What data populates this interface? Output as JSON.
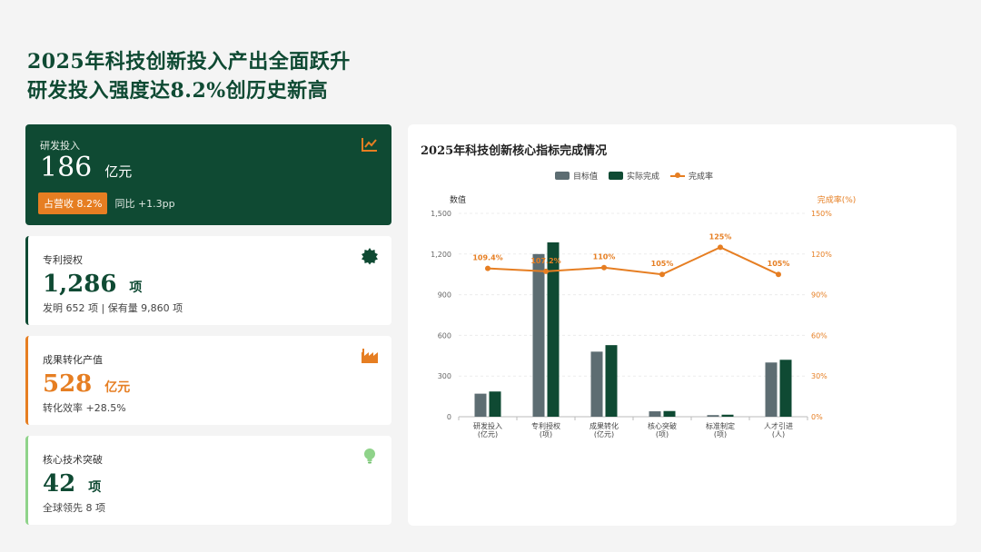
{
  "headline": {
    "line1": "2025年科技创新投入产出全面跃升",
    "line2": "研发投入强度达8.2%创历史新高"
  },
  "cards": {
    "rd": {
      "label": "研发投入",
      "value": "186",
      "unit": "亿元",
      "badge": "占营收 8.2%",
      "yoy": "同比 +1.3pp",
      "icon": "trend-chart-icon"
    },
    "patent": {
      "label": "专利授权",
      "value": "1,286",
      "unit": "项",
      "note": "发明 652 项 | 保有量 9,860 项",
      "icon": "seal-badge-icon"
    },
    "transfer": {
      "label": "成果转化产值",
      "value": "528",
      "unit": "亿元",
      "note": "转化效率 +28.5%",
      "icon": "factory-icon"
    },
    "breakthrough": {
      "label": "核心技术突破",
      "value": "42",
      "unit": "项",
      "note": "全球领先 8 项",
      "icon": "lightbulb-icon"
    }
  },
  "colors": {
    "brand": "#0f4a33",
    "accent": "#e67e22",
    "target": "#5d6d72",
    "light_green": "#8fd38a"
  },
  "chart_data": {
    "type": "bar",
    "title": "2025年科技创新核心指标完成情况",
    "categories": [
      "研发投入\n(亿元)",
      "专利授权\n(项)",
      "成果转化\n(亿元)",
      "核心突破\n(项)",
      "标准制定\n(项)",
      "人才引进\n(人)"
    ],
    "series": [
      {
        "name": "目标值",
        "type": "bar",
        "axis": "left",
        "color": "#5d6d72",
        "values": [
          170,
          1200,
          480,
          40,
          12,
          400
        ]
      },
      {
        "name": "实际完成",
        "type": "bar",
        "axis": "left",
        "color": "#0f4a33",
        "values": [
          186,
          1286,
          528,
          42,
          15,
          420
        ]
      },
      {
        "name": "完成率",
        "type": "line",
        "axis": "right",
        "color": "#e67e22",
        "values": [
          109.4,
          107.2,
          110,
          105,
          125,
          105
        ]
      }
    ],
    "data_labels": [
      "109.4%",
      "107.2%",
      "110%",
      "105%",
      "125%",
      "105%"
    ],
    "ylabel": "数值",
    "y2label": "完成率(%)",
    "ylim": [
      0,
      1500
    ],
    "yticks": [
      "0",
      "300",
      "600",
      "900",
      "1,200",
      "1,500"
    ],
    "y2lim": [
      0,
      150
    ],
    "y2ticks": [
      "0%",
      "30%",
      "60%",
      "90%",
      "120%",
      "150%"
    ],
    "grid": true,
    "legend": "top-center"
  }
}
